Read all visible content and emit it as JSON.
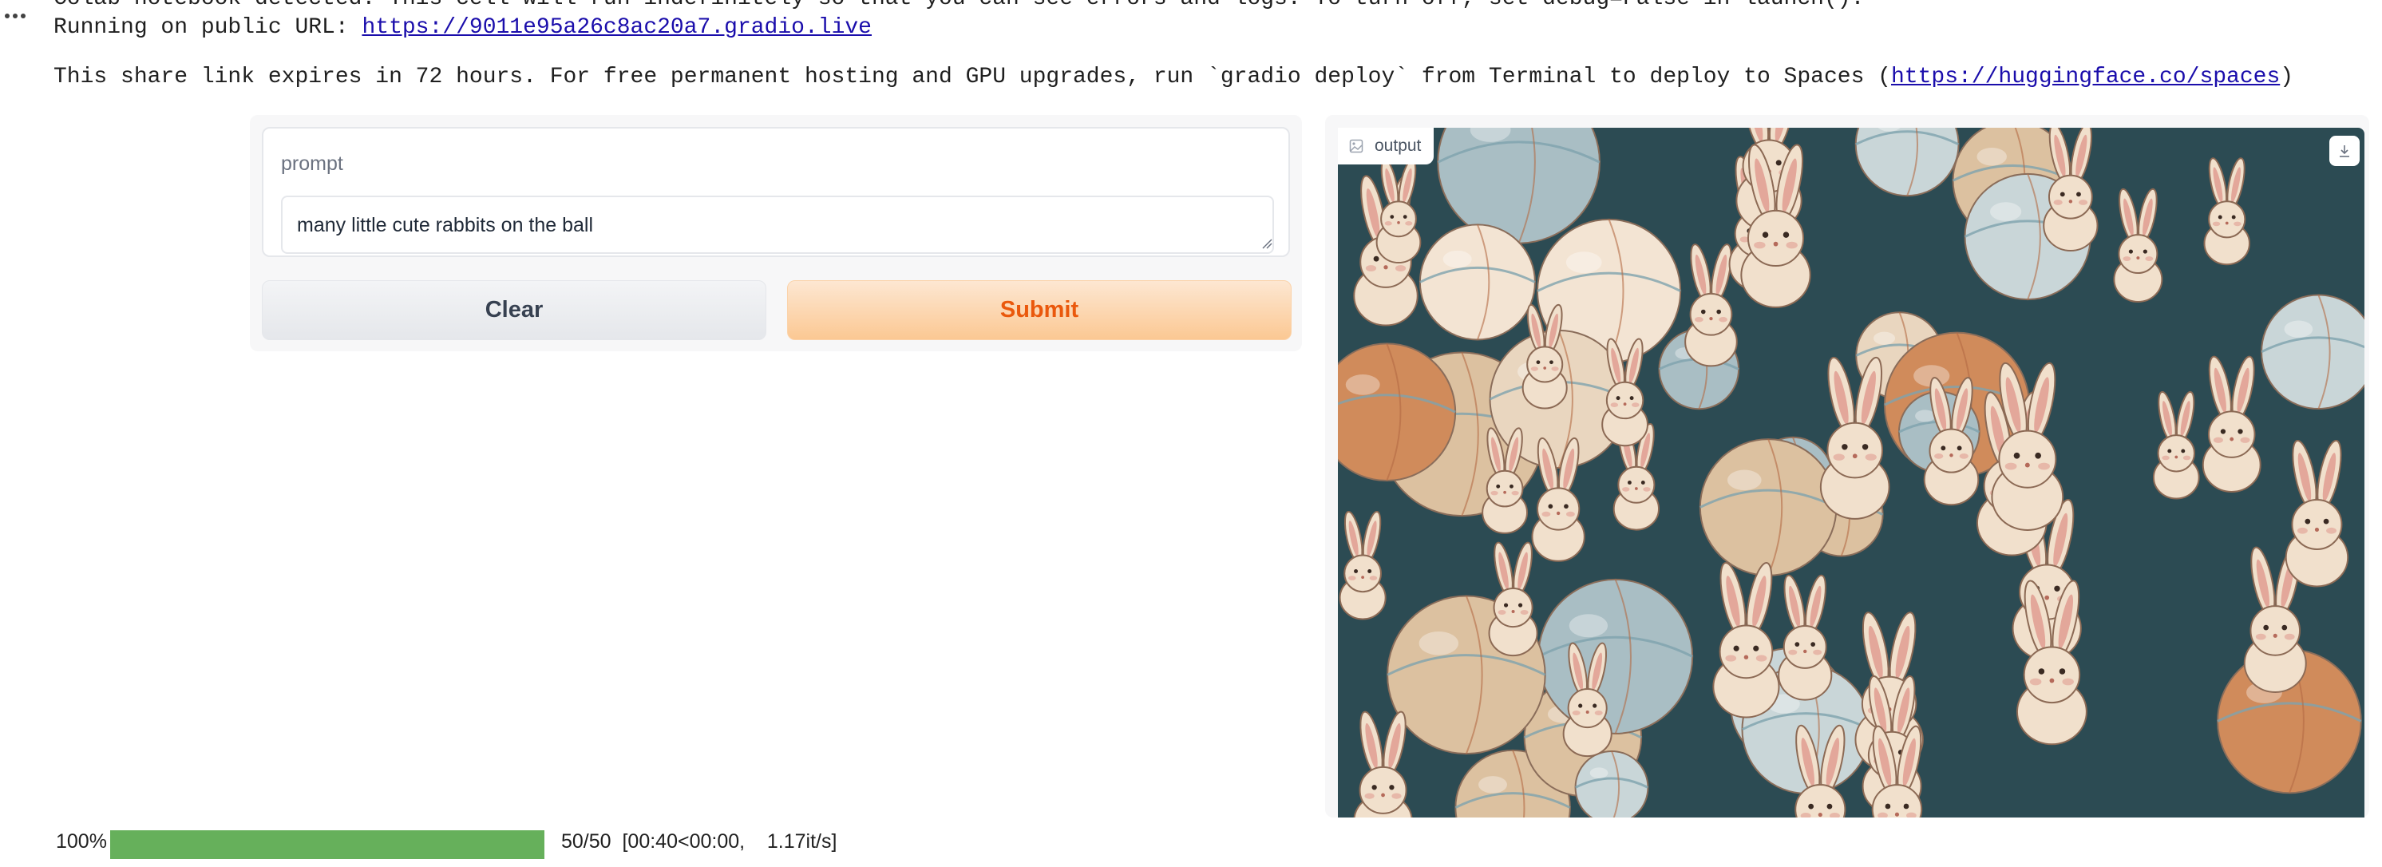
{
  "output": {
    "line1": "Colab notebook detected. This cell will run indefinitely so that you can see errors and logs. To turn off, set debug=False in launch().",
    "line2_prefix": "Running on public URL: ",
    "public_url": "https://9011e95a26c8ac20a7.gradio.live",
    "line3_prefix": "This share link expires in 72 hours. For free permanent hosting and GPU upgrades, run `gradio deploy` from Terminal to deploy to Spaces (",
    "spaces_url": "https://huggingface.co/spaces",
    "line3_suffix": ")"
  },
  "app": {
    "prompt_label": "prompt",
    "prompt_value": "many little cute rabbits on the ball",
    "clear_label": "Clear",
    "submit_label": "Submit",
    "output_label": "output"
  },
  "progress": {
    "percent_text": "100%",
    "fraction": 1.0,
    "steps": "50/50",
    "timing": "[00:40<00:00,",
    "rate": "1.17it/s]"
  },
  "colors": {
    "accent": "#ea580c",
    "progress_fill": "#66b05b",
    "link": "#1a0dab",
    "image_background": "#2c4b53"
  },
  "icons": [
    "more-dots-icon",
    "image-icon",
    "download-icon"
  ]
}
